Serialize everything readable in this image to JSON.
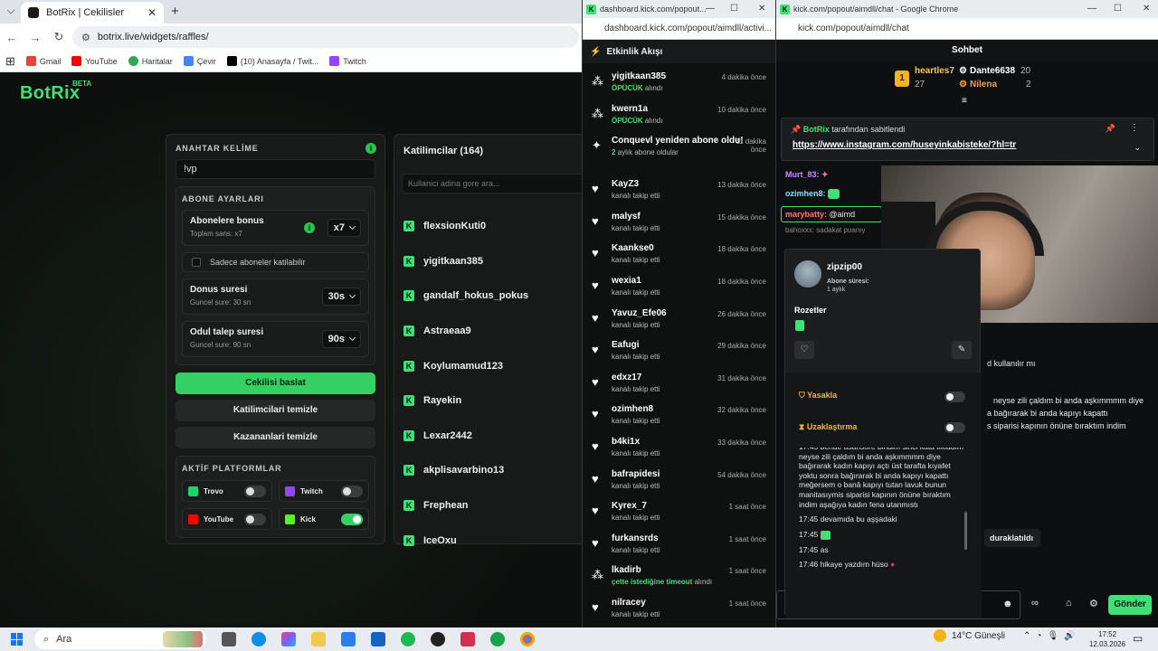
{
  "browser1": {
    "tab_title": "BotRix | Cekilisler",
    "url": "botrix.live/widgets/raffles/",
    "bookmarks": [
      "Gmail",
      "YouTube",
      "Haritalar",
      "Çevir",
      "(10) Anasayfa / Twit...",
      "Twitch"
    ]
  },
  "botrix": {
    "logo": "BotRix",
    "logo_badge": "BETA",
    "keyword": {
      "label": "ANAHTAR KELİME",
      "value": "!vp"
    },
    "subscriber_settings": {
      "title": "ABONE AYARLARI",
      "bonus": {
        "title": "Abonelere bonus",
        "sub": "Toplam sans: x7",
        "value": "x7"
      },
      "subs_only": "Sadece aboneler katilabilir",
      "cooldown": {
        "title": "Donus suresi",
        "sub": "Guncel sure: 30 sn",
        "value": "30s"
      },
      "claim": {
        "title": "Odul talep suresi",
        "sub": "Guncel sure: 90 sn",
        "value": "90s"
      }
    },
    "buttons": {
      "start": "Cekilisi baslat",
      "clear_participants": "Katilimcilari temizle",
      "clear_winners": "Kazananlari temizle"
    },
    "platforms": {
      "title": "AKTİF PLATFORMLAR",
      "items": [
        {
          "name": "Trovo",
          "enabled": false,
          "color": "#19d66b"
        },
        {
          "name": "Twitch",
          "enabled": false,
          "color": "#9146ff"
        },
        {
          "name": "YouTube",
          "enabled": false,
          "color": "#ff0000"
        },
        {
          "name": "Kick",
          "enabled": true,
          "color": "#53fc18"
        }
      ]
    },
    "participants": {
      "title": "Katilimcilar (164)",
      "search_placeholder": "Kullanici adina gore ara...",
      "items": [
        "flexsionKuti0",
        "yigitkaan385",
        "gandalf_hokus_pokus",
        "Astraeaa9",
        "Koylumamud123",
        "Rayekin",
        "Lexar2442",
        "akplisavarbino13",
        "Frephean",
        "IceOxu"
      ]
    }
  },
  "activity": {
    "window_title": "dashboard.kick.com/popout...",
    "url": "dashboard.kick.com/popout/aimdll/activi...",
    "header": "Etkinlik Akışı",
    "items": [
      {
        "name": "yigitkaan385",
        "hl": "ÖPÜCÜK",
        "sub": " alındı",
        "time": "4 dakika önce",
        "icon": "gift"
      },
      {
        "name": "kwern1a",
        "hl": "ÖPÜCÜK",
        "sub": " alındı",
        "time": "10 dakika önce",
        "icon": "gift"
      },
      {
        "name": "Conquevl yeniden abone oldu!",
        "hl": "2",
        "sub": " aylık abone oldular",
        "time": "11 dakika önce",
        "icon": "star"
      },
      {
        "name": "KayZ3",
        "hl": "",
        "sub": "kanalı takip etti",
        "time": "13 dakika önce",
        "icon": "heart"
      },
      {
        "name": "malysf",
        "hl": "",
        "sub": "kanalı takip etti",
        "time": "15 dakika önce",
        "icon": "heart"
      },
      {
        "name": "Kaankse0",
        "hl": "",
        "sub": "kanalı takip etti",
        "time": "18 dakika önce",
        "icon": "heart"
      },
      {
        "name": "wexia1",
        "hl": "",
        "sub": "kanalı takip etti",
        "time": "18 dakika önce",
        "icon": "heart"
      },
      {
        "name": "Yavuz_Efe06",
        "hl": "",
        "sub": "kanalı takip etti",
        "time": "26 dakika önce",
        "icon": "heart"
      },
      {
        "name": "Eafugi",
        "hl": "",
        "sub": "kanalı takip etti",
        "time": "29 dakika önce",
        "icon": "heart"
      },
      {
        "name": "edxz17",
        "hl": "",
        "sub": "kanalı takip etti",
        "time": "31 dakika önce",
        "icon": "heart"
      },
      {
        "name": "ozimhen8",
        "hl": "",
        "sub": "kanalı takip etti",
        "time": "32 dakika önce",
        "icon": "heart"
      },
      {
        "name": "b4ki1x",
        "hl": "",
        "sub": "kanalı takip etti",
        "time": "33 dakika önce",
        "icon": "heart"
      },
      {
        "name": "bafrapidesi",
        "hl": "",
        "sub": "kanalı takip etti",
        "time": "54 dakika önce",
        "icon": "heart"
      },
      {
        "name": "Kyrex_7",
        "hl": "",
        "sub": "kanalı takip etti",
        "time": "1 saat önce",
        "icon": "heart"
      },
      {
        "name": "furkansrds",
        "hl": "",
        "sub": "kanalı takip etti",
        "time": "1 saat önce",
        "icon": "heart"
      },
      {
        "name": "lkadirb",
        "hl": "çette istediğine timeout",
        "sub": " alındı",
        "time": "1 saat önce",
        "icon": "gift"
      },
      {
        "name": "nilracey",
        "hl": "",
        "sub": "kanalı takip etti",
        "time": "1 saat önce",
        "icon": "heart"
      }
    ]
  },
  "chat": {
    "window_title": "kick.com/popout/aimdll/chat - Google Chrome",
    "url": "kick.com/popout/aimdll/chat",
    "header": "Sohbet",
    "top_gifters": [
      {
        "name": "heartles7",
        "count": "27"
      },
      {
        "name": "Dante6638",
        "count": "20"
      },
      {
        "name": "Nilena",
        "count": "2"
      }
    ],
    "pinned_by": "BotRix",
    "pinned_suffix": "tarafından sabitlendi",
    "pinned_link": "https://www.instagram.com/huseyinkabisteke/?hl=tr",
    "messages": [
      {
        "user": "Murt_83:",
        "color": "#c88cff"
      },
      {
        "user": "ozimhen8:",
        "color": "#7fe1ff"
      },
      {
        "user": "marybatty:",
        "text": "@aimd",
        "color": "#ff7777"
      }
    ],
    "reply_preview": "bahoxxx: sadakat puanıy",
    "side_text": [
      "d kullanılır mı",
      "neyse zili çaldım bi anda aşkımmmm diye",
      "a bağırarak bi anda kapıyı kapattı",
      "s siparisi kapının önüne bıraktım indim",
      "duraklatıldı"
    ],
    "profile": {
      "name": "zipzip00",
      "sub_label": "Abone süresi:",
      "sub_value": "1 aylık",
      "badges_label": "Rozetler",
      "ban": "Yasakla",
      "timeout": "Uzaklaştırma"
    },
    "history": [
      "17:45 bende asansore bindim sinci kata tıkladım neyse zili çaldım bi anda aşkımmmm diye bağırarak kadın kapıyı açtı üst tarafta kıyafet yoktu sonra bağırarak bi anda kapıyı kapattı meğersem o banâ kapıyı tutan lavuk bunun manitasıymis siparisi kapının önüne bıraktım indim aşağıya kadın fena utanmıstı",
      "17:45 devamıda bu aşşadaki",
      "17:45",
      "17:45 as",
      "17:46 hikaye yazdım hüso"
    ],
    "send": "Gönder"
  },
  "taskbar": {
    "search": "Ara",
    "weather": "14°C  Güneşli",
    "time": "17:52",
    "date": "12.03.2026"
  }
}
